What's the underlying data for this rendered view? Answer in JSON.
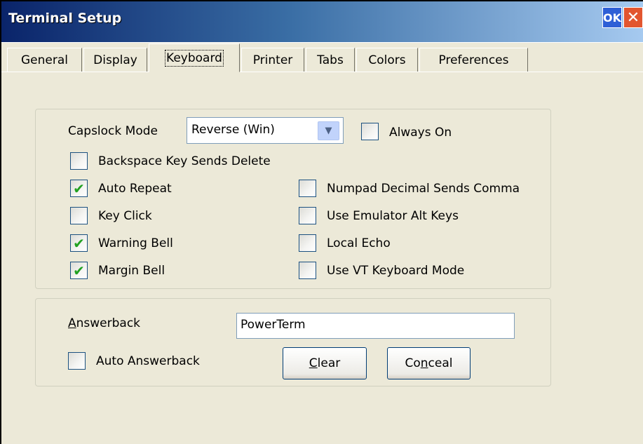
{
  "window": {
    "title": "Terminal Setup",
    "ok_label": "OK",
    "close_label": "✕"
  },
  "tabs": [
    {
      "label": "General"
    },
    {
      "label": "Display"
    },
    {
      "label": "Keyboard",
      "active": true
    },
    {
      "label": "Printer"
    },
    {
      "label": "Tabs"
    },
    {
      "label": "Colors"
    },
    {
      "label": "Preferences"
    }
  ],
  "keyboard": {
    "capslock_label": "Capslock Mode",
    "capslock_value": "Reverse (Win)",
    "always_on_label": "Always On",
    "always_on_checked": false,
    "options": {
      "backspace_delete": {
        "label": "Backspace Key Sends Delete",
        "checked": false
      },
      "auto_repeat": {
        "label": "Auto Repeat",
        "checked": true
      },
      "key_click": {
        "label": "Key Click",
        "checked": false
      },
      "warning_bell": {
        "label": "Warning Bell",
        "checked": true
      },
      "margin_bell": {
        "label": "Margin Bell",
        "checked": true
      },
      "numpad_comma": {
        "label": "Numpad Decimal Sends Comma",
        "checked": false
      },
      "emulator_alt": {
        "label": "Use Emulator Alt Keys",
        "checked": false
      },
      "local_echo": {
        "label": "Local Echo",
        "checked": false
      },
      "vt_keyboard": {
        "label": "Use VT Keyboard Mode",
        "checked": false
      }
    }
  },
  "answerback": {
    "label_mnemonic": "A",
    "label_rest": "nswerback",
    "value": "PowerTerm",
    "auto_label": "Auto Answerback",
    "auto_checked": false,
    "clear_mnemonic": "C",
    "clear_rest": "lear",
    "conceal_pre": "Co",
    "conceal_mnemonic": "n",
    "conceal_rest": "ceal"
  },
  "colors": {
    "check": "#21a121",
    "window_bg": "#ece9d8",
    "title_start": "#0a246a"
  },
  "icons": {
    "checkmark": "check-icon",
    "dropdown": "chevron-down-icon"
  }
}
